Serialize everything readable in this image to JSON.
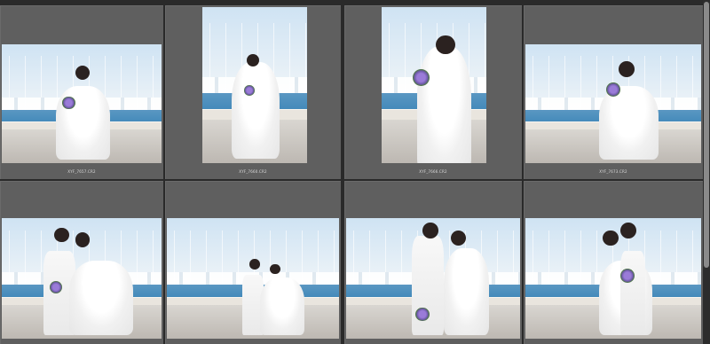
{
  "grid": {
    "rows": [
      [
        {
          "filename": "XYF_7657.CR2",
          "label": "wedding photo 1"
        },
        {
          "filename": "XYF_7660.CR2",
          "label": "wedding photo 2"
        },
        {
          "filename": "XYF_7666.CR2",
          "label": "wedding photo 3"
        },
        {
          "filename": "XYF_7673.CR2",
          "label": "wedding photo 4"
        }
      ],
      [
        {
          "filename": "",
          "label": "wedding photo 5"
        },
        {
          "filename": "",
          "label": "wedding photo 6"
        },
        {
          "filename": "",
          "label": "wedding photo 7"
        },
        {
          "filename": "",
          "label": "wedding photo 8"
        }
      ]
    ]
  },
  "colors": {
    "cell_bg": "#5f5f5f",
    "grid_bg": "#2a2a2a",
    "caption_text": "#dcdcdc"
  }
}
